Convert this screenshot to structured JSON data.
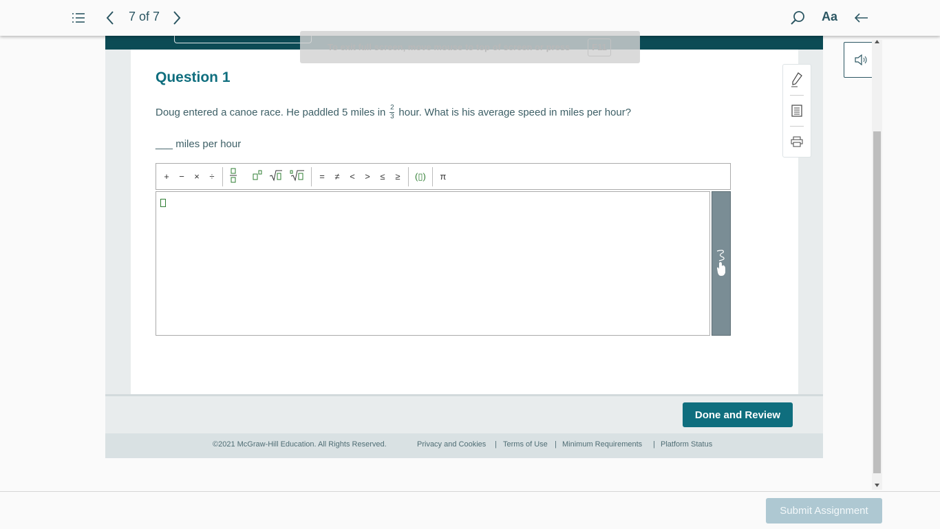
{
  "nav": {
    "page_counter": "7 of 7",
    "font_size_label": "Aa"
  },
  "fullscreen_notice": {
    "text": "To exit full screen, move mouse to top of screen or press",
    "key": "F11"
  },
  "question": {
    "title": "Question 1",
    "text_before": "Doug entered a canoe race. He paddled 5 miles in",
    "fraction_numerator": "2",
    "fraction_denominator": "3",
    "text_after": "hour. What is his average speed in miles per hour?",
    "answer_prompt": "___ miles per hour"
  },
  "math_toolbar": {
    "plus": "+",
    "minus": "−",
    "times": "×",
    "divide": "÷",
    "eq": "=",
    "neq": "≠",
    "lt": "<",
    "gt": ">",
    "le": "≤",
    "ge": "≥",
    "paren": "(▯)",
    "pi": "π"
  },
  "actions": {
    "done_review": "Done and Review",
    "submit": "Submit Assignment"
  },
  "footer": {
    "copyright": "©2021 McGraw-Hill Education. All Rights Reserved.",
    "privacy": "Privacy and Cookies",
    "terms": "Terms of Use",
    "requirements": "Minimum Requirements",
    "status": "Platform Status",
    "separator": "|"
  },
  "colors": {
    "brand_teal": "#0f6e7e",
    "dark_teal": "#0c4b55",
    "submit_disabled": "#aec8d2"
  },
  "icons": [
    "list-icon",
    "chevron-left-icon",
    "chevron-right-icon",
    "search-icon",
    "back-arrow-icon",
    "speaker-icon",
    "pencil-icon",
    "notes-icon",
    "print-icon",
    "handwriting-icon"
  ]
}
